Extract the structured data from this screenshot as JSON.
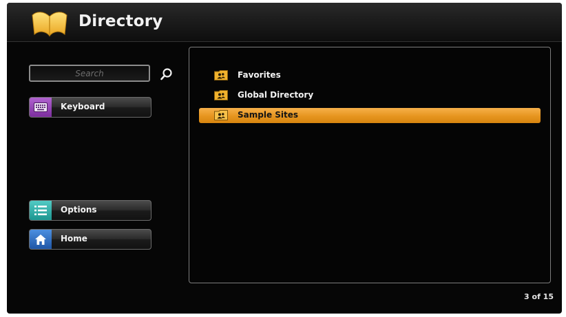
{
  "app": {
    "title": "Directory",
    "icon": "open-book-icon"
  },
  "search": {
    "placeholder": "Search",
    "value": "",
    "icon": "search-icon"
  },
  "sidebar": {
    "buttons": [
      {
        "label": "Keyboard",
        "icon": "keyboard-icon",
        "color": "#9a48bd"
      },
      {
        "label": "Options",
        "icon": "list-icon",
        "color": "#36b3ad"
      },
      {
        "label": "Home",
        "icon": "home-icon",
        "color": "#2f6fc6"
      }
    ]
  },
  "directory": {
    "items": [
      {
        "label": "Favorites",
        "icon": "contacts-folder-icon",
        "selected": false
      },
      {
        "label": "Global Directory",
        "icon": "contacts-folder-icon",
        "selected": false
      },
      {
        "label": "Sample Sites",
        "icon": "contacts-folder-icon",
        "selected": true
      }
    ],
    "selection_color": "#ee9f2a"
  },
  "pagination": {
    "text": "3 of 15"
  }
}
